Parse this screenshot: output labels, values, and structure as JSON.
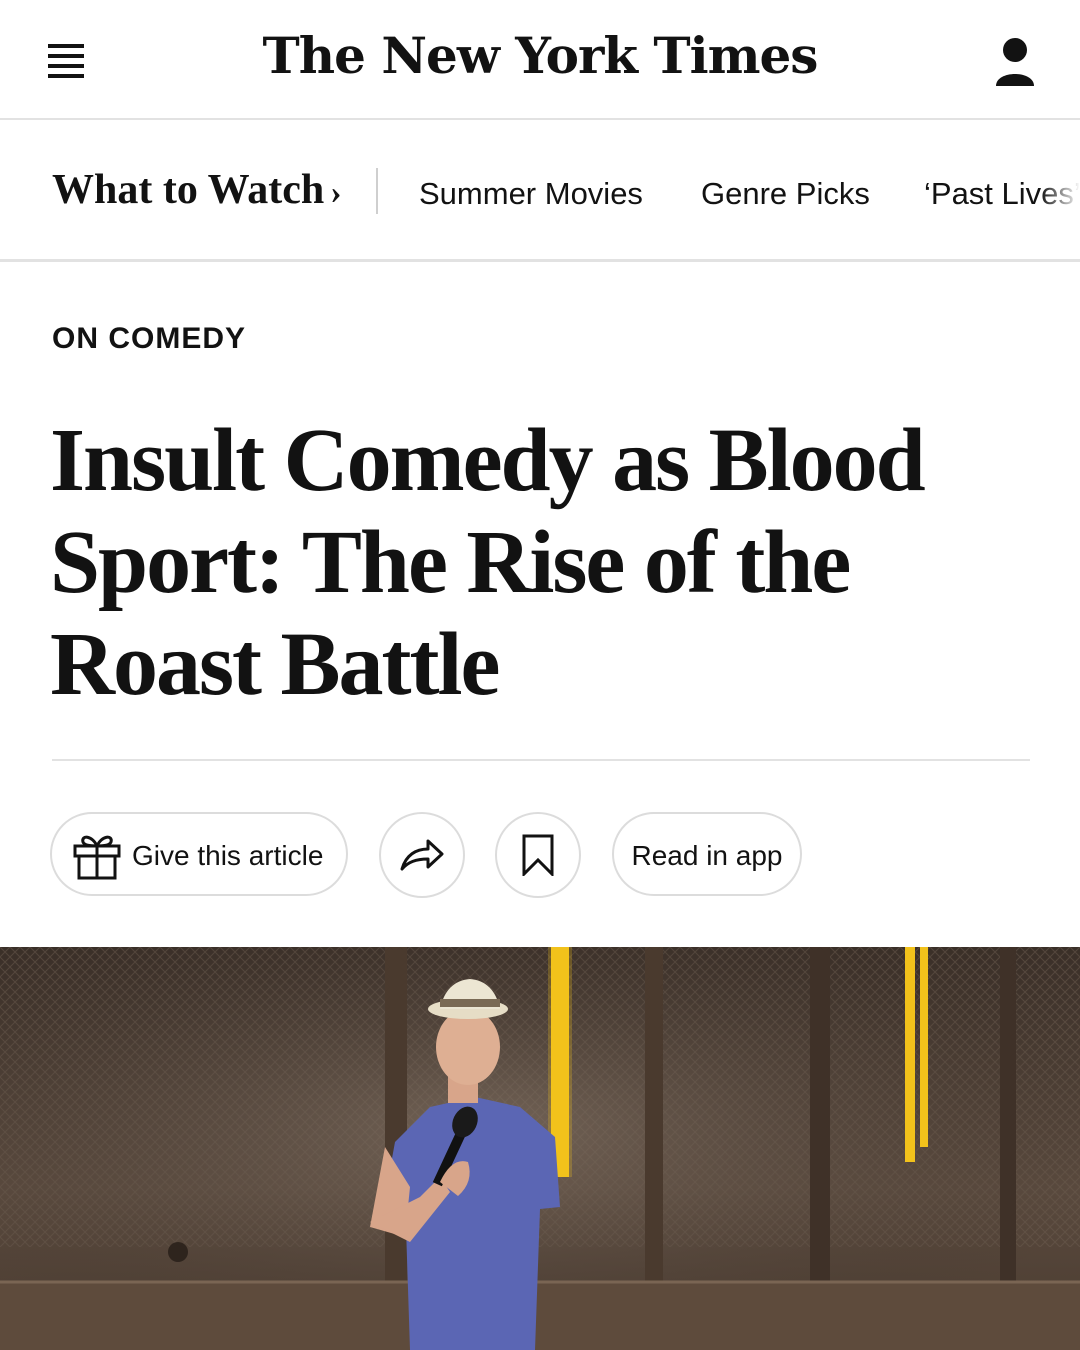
{
  "masthead": {
    "logo_text": "The New York Times",
    "menu_icon": "hamburger-menu-icon",
    "account_icon": "user-account-icon"
  },
  "section_nav": {
    "title": "What to Watch",
    "chevron": "›",
    "links": [
      "Summer Movies",
      "Genre Picks",
      "‘Past Lives’"
    ]
  },
  "article": {
    "kicker": "ON COMEDY",
    "headline": "Insult Comedy as Blood Sport: The Rise of the Roast Battle"
  },
  "actions": {
    "gift_label": "Give this article",
    "gift_icon": "gift-icon",
    "share_icon": "share-arrow-icon",
    "bookmark_icon": "bookmark-icon",
    "app_label": "Read in app"
  },
  "photo": {
    "subject": "comedian-on-stage-photo"
  },
  "colors": {
    "text": "#121212",
    "divider": "#e2e2e2",
    "button_border": "#dcdcdc",
    "shirt": "#5b66b4",
    "stage_light": "#f2c21b"
  }
}
